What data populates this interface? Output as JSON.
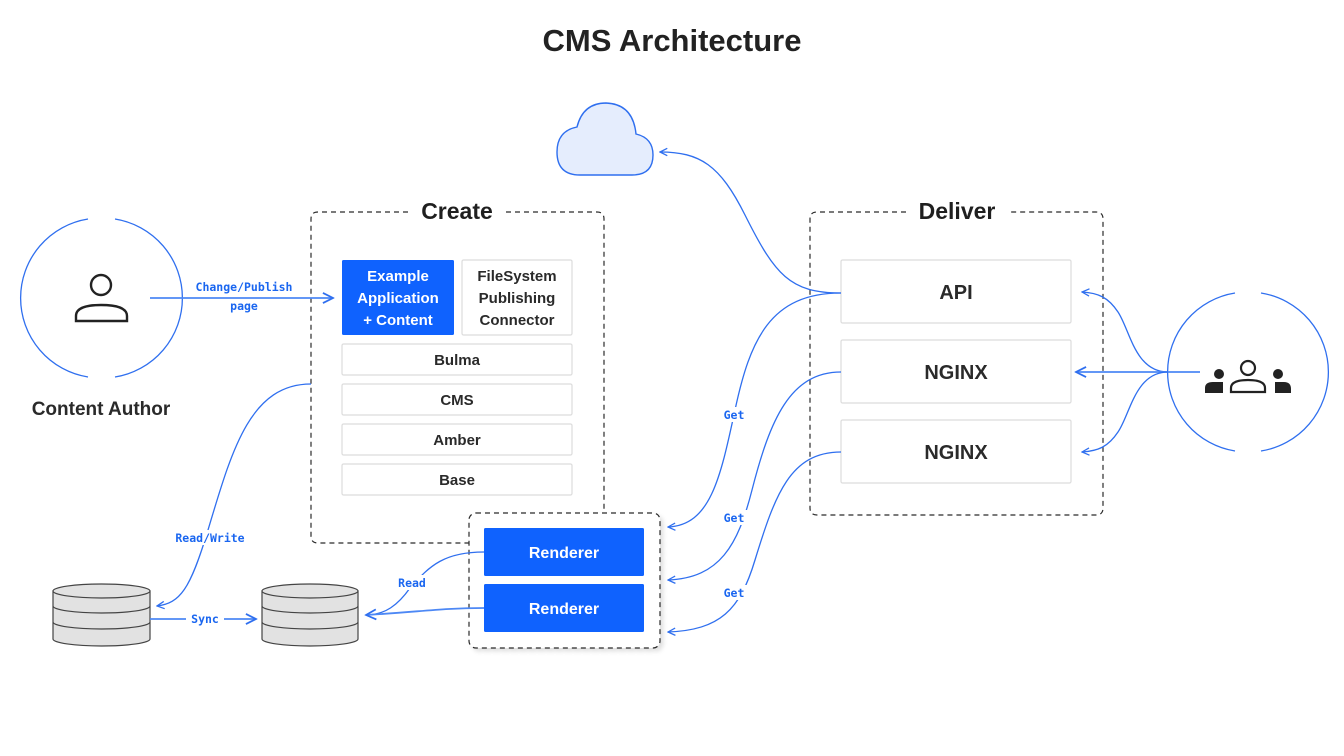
{
  "title": "CMS Architecture",
  "colors": {
    "accent_blue": "#0f62fe",
    "edge_blue": "#2f6fef",
    "cloud_fill": "#e5edfd",
    "text_dark": "#222222",
    "database_fill": "#e2e2e2"
  },
  "actors": {
    "content_author": {
      "label": "Content Author",
      "icon": "person-icon"
    },
    "end_users": {
      "label": "",
      "icon": "user-group-icon"
    }
  },
  "groups": {
    "create": {
      "title": "Create",
      "primary_node": {
        "lines": [
          "Example",
          "Application",
          "+ Content"
        ]
      },
      "connector_node": {
        "lines": [
          "FileSystem",
          "Publishing",
          "Connector"
        ]
      },
      "layers": [
        "Bulma",
        "CMS",
        "Amber",
        "Base"
      ]
    },
    "deliver": {
      "title": "Deliver",
      "nodes": [
        "API",
        "NGINX",
        "NGINX"
      ]
    },
    "renderers": {
      "nodes": [
        "Renderer",
        "Renderer"
      ]
    }
  },
  "storage": {
    "databases": [
      "primary-database",
      "replica-database"
    ],
    "cloud": "cloud-icon"
  },
  "edges": {
    "change_publish": [
      "Change/Publish",
      "page"
    ],
    "read_write": "Read/Write",
    "sync": "Sync",
    "read": "Read",
    "get_1": "Get",
    "get_2": "Get",
    "get_3": "Get"
  }
}
